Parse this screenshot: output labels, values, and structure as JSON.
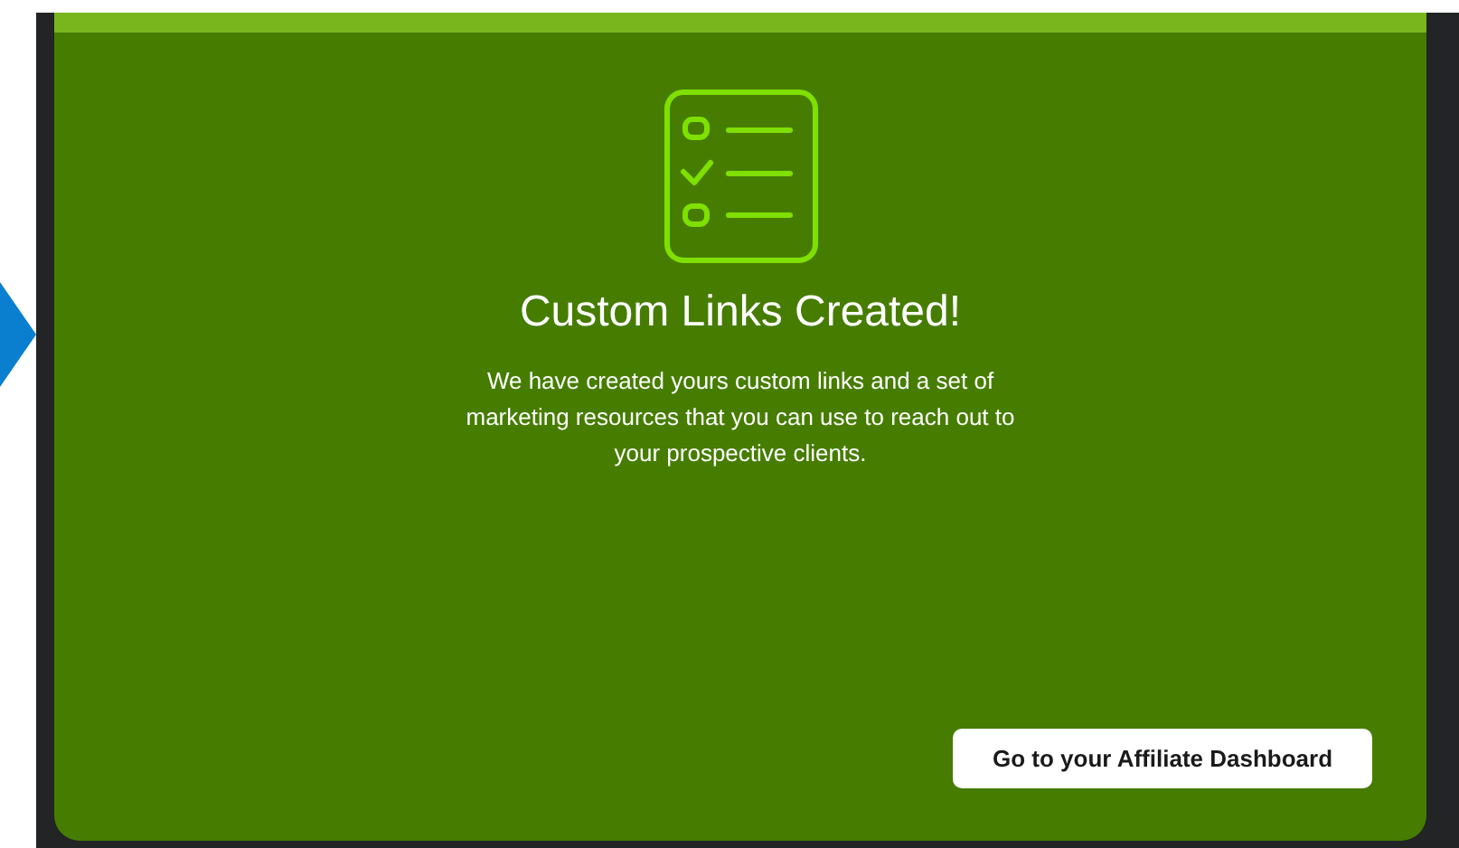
{
  "card": {
    "title": "Custom Links Created!",
    "message": "We have created yours custom links and a set of marketing resources that you can use to reach out to your prospective clients.",
    "button": "Go to your Affiliate Dashboard"
  }
}
